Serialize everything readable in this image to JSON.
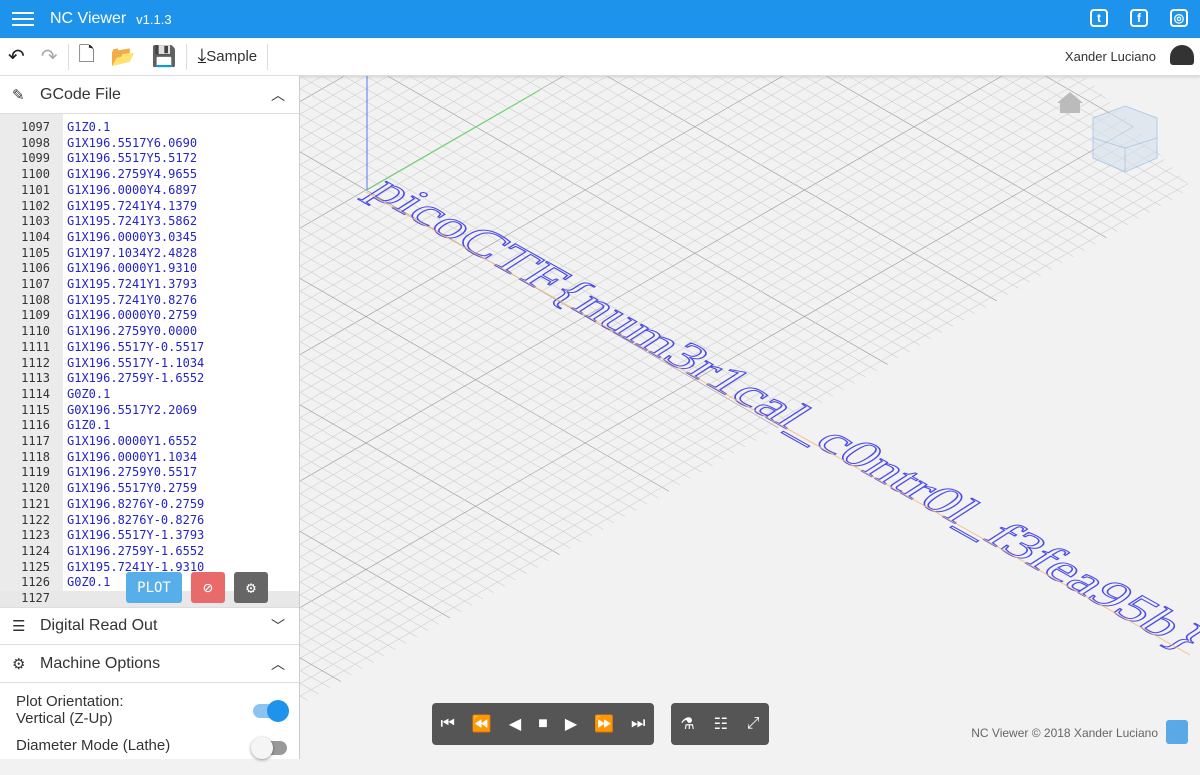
{
  "header": {
    "title": "NC Viewer",
    "version": "v1.1.3",
    "social": [
      "twitter-icon",
      "facebook-icon",
      "instagram-icon"
    ]
  },
  "toolbar": {
    "sample_label": "Sample",
    "user": "Xander Luciano"
  },
  "gcode": {
    "title": "GCode File",
    "lines": [
      {
        "n": "1097",
        "t": "G1Z0.1"
      },
      {
        "n": "1098",
        "t": "G1X196.5517Y6.0690"
      },
      {
        "n": "1099",
        "t": "G1X196.5517Y5.5172"
      },
      {
        "n": "1100",
        "t": "G1X196.2759Y4.9655"
      },
      {
        "n": "1101",
        "t": "G1X196.0000Y4.6897"
      },
      {
        "n": "1102",
        "t": "G1X195.7241Y4.1379"
      },
      {
        "n": "1103",
        "t": "G1X195.7241Y3.5862"
      },
      {
        "n": "1104",
        "t": "G1X196.0000Y3.0345"
      },
      {
        "n": "1105",
        "t": "G1X197.1034Y2.4828"
      },
      {
        "n": "1106",
        "t": "G1X196.0000Y1.9310"
      },
      {
        "n": "1107",
        "t": "G1X195.7241Y1.3793"
      },
      {
        "n": "1108",
        "t": "G1X195.7241Y0.8276"
      },
      {
        "n": "1109",
        "t": "G1X196.0000Y0.2759"
      },
      {
        "n": "1110",
        "t": "G1X196.2759Y0.0000"
      },
      {
        "n": "1111",
        "t": "G1X196.5517Y-0.5517"
      },
      {
        "n": "1112",
        "t": "G1X196.5517Y-1.1034"
      },
      {
        "n": "1113",
        "t": "G1X196.2759Y-1.6552"
      },
      {
        "n": "1114",
        "t": "G0Z0.1"
      },
      {
        "n": "1115",
        "t": "G0X196.5517Y2.2069"
      },
      {
        "n": "1116",
        "t": "G1Z0.1"
      },
      {
        "n": "1117",
        "t": "G1X196.0000Y1.6552"
      },
      {
        "n": "1118",
        "t": "G1X196.0000Y1.1034"
      },
      {
        "n": "1119",
        "t": "G1X196.2759Y0.5517"
      },
      {
        "n": "1120",
        "t": "G1X196.5517Y0.2759"
      },
      {
        "n": "1121",
        "t": "G1X196.8276Y-0.2759"
      },
      {
        "n": "1122",
        "t": "G1X196.8276Y-0.8276"
      },
      {
        "n": "1123",
        "t": "G1X196.5517Y-1.3793"
      },
      {
        "n": "1124",
        "t": "G1X196.2759Y-1.6552"
      },
      {
        "n": "1125",
        "t": "G1X195.7241Y-1.9310"
      },
      {
        "n": "1126",
        "t": "G0Z0.1"
      },
      {
        "n": "1127",
        "t": ""
      }
    ],
    "plot_label": "PLOT"
  },
  "dro": {
    "title": "Digital Read Out"
  },
  "machine": {
    "title": "Machine Options",
    "plot_orientation_label": "Plot Orientation:",
    "plot_orientation_value": "Vertical (Z-Up)",
    "plot_orientation_on": true,
    "diameter_mode_label": "Diameter Mode (Lathe)",
    "diameter_mode_on": false
  },
  "viewer": {
    "plotted_text": "picoCTF{num3r1cal_c0ntr0l_f3fea95b}",
    "footer": "NC Viewer © 2018 Xander Luciano",
    "colors": {
      "cut": "#4a4ae8",
      "rapid": "#f5b87a",
      "accent": "#1e93ec"
    }
  }
}
